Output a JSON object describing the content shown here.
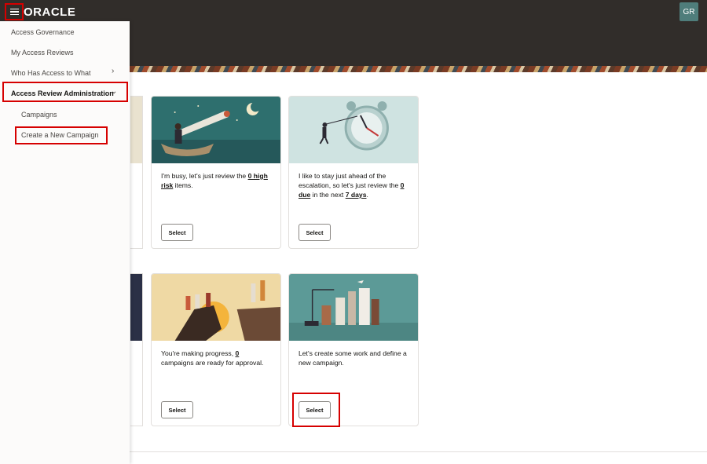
{
  "header": {
    "logo_text": "ORACLE",
    "avatar_initials": "GR"
  },
  "nav": {
    "items": [
      {
        "label": "Access Governance"
      },
      {
        "label": "My Access Reviews"
      },
      {
        "label": "Who Has Access to What"
      },
      {
        "label": "Access Review Administration"
      },
      {
        "label": "Campaigns"
      },
      {
        "label": "Create a New Campaign"
      }
    ]
  },
  "cards": [
    {
      "text_parts": [
        "I'm busy, let's just review the ",
        "0 high risk",
        " items."
      ],
      "button_label": "Select"
    },
    {
      "text_parts": [
        "I like to stay just ahead of the escalation, so let's just review the ",
        "0 due",
        " in the next ",
        "7 days",
        "."
      ],
      "button_label": "Select"
    },
    {
      "text_parts": [
        "You're making progress, ",
        "0",
        " campaigns are ready for approval."
      ],
      "button_label": "Select"
    },
    {
      "text_parts": [
        "Let's create some work and define a new campaign."
      ],
      "button_label": "Select"
    }
  ],
  "colors": {
    "header_bg": "#312d2a",
    "highlight": "#d60000",
    "avatar_bg": "#4f7d7b"
  }
}
